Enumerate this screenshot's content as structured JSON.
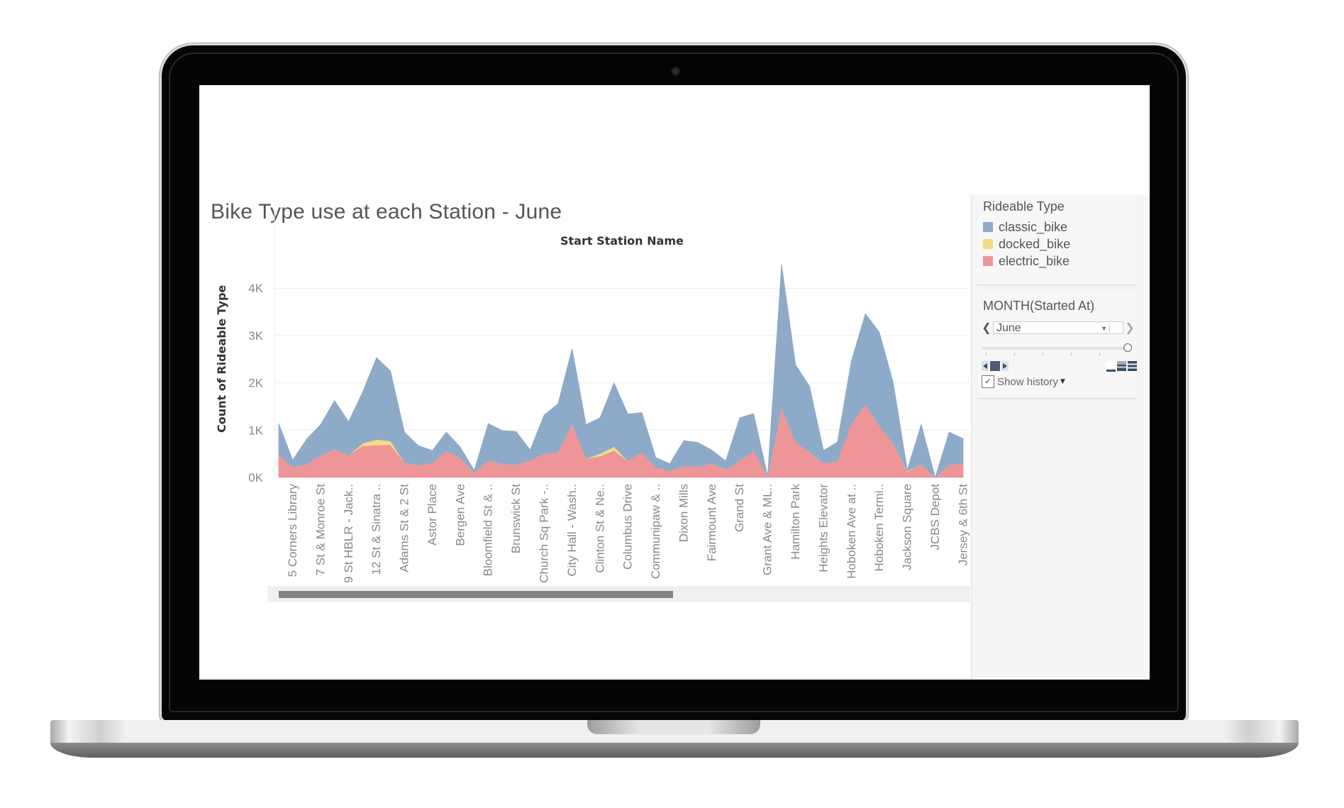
{
  "dashboard": {
    "title": "Bike Type use at each Station - June",
    "x_header": "Start Station Name",
    "y_title": "Count of Rideable Type"
  },
  "legend": {
    "title": "Rideable Type",
    "items": [
      {
        "label": "classic_bike",
        "color": "#8eaac9"
      },
      {
        "label": "docked_bike",
        "color": "#f4dc86"
      },
      {
        "label": "electric_bike",
        "color": "#ee9598"
      }
    ]
  },
  "filter": {
    "title": "MONTH(Started At)",
    "selected": "June",
    "prev_icon": "chevron-left-icon",
    "next_icon": "chevron-right-icon",
    "slider_position": 1.0,
    "show_history_label": "Show history",
    "show_history_checked": true
  },
  "scrollbar": {
    "visible_fraction": 0.58,
    "offset_fraction": 0.0
  },
  "chart_data": {
    "type": "area",
    "stacked": true,
    "title": "Bike Type use at each Station - June",
    "xlabel": "Start Station Name",
    "ylabel": "Count of Rideable Type",
    "ylim": [
      0,
      4500
    ],
    "yticks": [
      0,
      1000,
      2000,
      3000,
      4000
    ],
    "ytick_labels": [
      "0K",
      "1K",
      "2K",
      "3K",
      "4K"
    ],
    "grid": true,
    "legend_position": "right",
    "x_tick_labels": [
      "5 Corners Library",
      "7 St & Monroe St",
      "9 St HBLR - Jack..",
      "12 St & Sinatra ..",
      "Adams St & 2 St",
      "Astor Place",
      "Bergen Ave",
      "Bloomfield St & ..",
      "Brunswick St",
      "Church Sq Park -..",
      "City Hall - Wash..",
      "Clinton St & Ne..",
      "Columbus Drive",
      "Communipaw & ..",
      "Dixon Mills",
      "Fairmount Ave",
      "Grand St",
      "Grant Ave & ML..",
      "Hamilton Park",
      "Heights Elevator",
      "Hoboken Ave at ..",
      "Hoboken Termi..",
      "Jackson Square",
      "JCBS Depot",
      "Jersey & 6th St"
    ],
    "point_count": 50,
    "series": [
      {
        "name": "electric_bike",
        "color": "#ee9598",
        "values": [
          480,
          220,
          280,
          460,
          600,
          470,
          670,
          680,
          690,
          320,
          260,
          310,
          560,
          420,
          100,
          360,
          290,
          270,
          360,
          500,
          530,
          1140,
          400,
          450,
          570,
          350,
          540,
          210,
          140,
          240,
          220,
          300,
          170,
          350,
          570,
          20,
          1470,
          750,
          540,
          300,
          340,
          1140,
          1540,
          1090,
          720,
          120,
          280,
          0,
          270,
          300
        ]
      },
      {
        "name": "docked_bike",
        "color": "#f4dc86",
        "values": [
          0,
          0,
          0,
          0,
          0,
          0,
          50,
          120,
          80,
          0,
          0,
          0,
          0,
          0,
          0,
          0,
          0,
          0,
          0,
          0,
          0,
          0,
          0,
          50,
          80,
          0,
          0,
          0,
          0,
          0,
          0,
          0,
          0,
          0,
          0,
          0,
          0,
          0,
          0,
          0,
          0,
          0,
          0,
          0,
          0,
          20,
          0,
          0,
          0,
          0
        ]
      },
      {
        "name": "classic_bike",
        "color": "#8eaac9",
        "values": [
          660,
          150,
          530,
          660,
          1020,
          710,
          1080,
          1730,
          1480,
          640,
          410,
          260,
          400,
          220,
          50,
          780,
          700,
          700,
          220,
          820,
          1030,
          1580,
          720,
          760,
          1350,
          990,
          830,
          210,
          150,
          540,
          520,
          280,
          180,
          910,
          780,
          10,
          3030,
          1630,
          1390,
          270,
          410,
          1320,
          1920,
          1980,
          1280,
          20,
          840,
          0,
          690,
          520
        ]
      }
    ]
  }
}
